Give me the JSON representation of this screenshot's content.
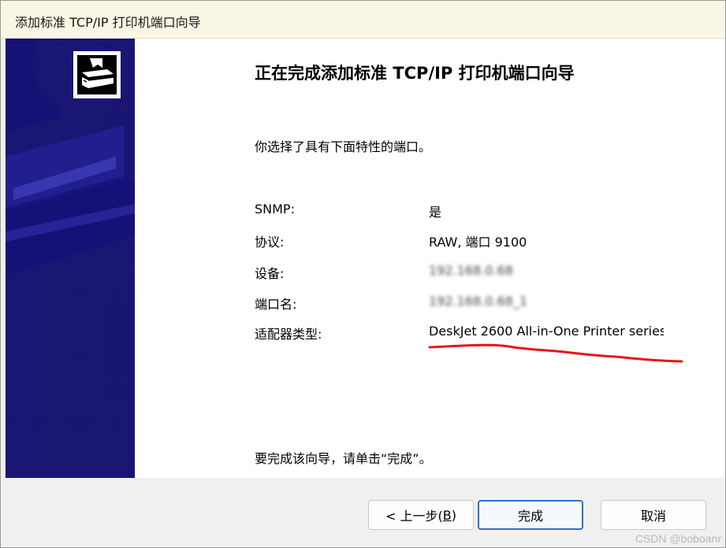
{
  "window": {
    "title": "添加标准 TCP/IP 打印机端口向导"
  },
  "banner": {
    "icon": "printer-wizard-icon",
    "color": "#1e1a8c"
  },
  "content": {
    "heading": "正在完成添加标准 TCP/IP 打印机端口向导",
    "intro": "你选择了具有下面特性的端口。",
    "properties": [
      {
        "label": "SNMP:",
        "value": "是"
      },
      {
        "label": "协议:",
        "value": "RAW, 端口 9100"
      },
      {
        "label": "设备:",
        "value": "192.168.0.68"
      },
      {
        "label": "端口名:",
        "value": "192.168.0.68_1"
      },
      {
        "label": "适配器类型:",
        "value": "DeskJet 2600 All-in-One Printer series"
      }
    ],
    "finish_note": "要完成该向导，请单击“完成”。"
  },
  "buttons": {
    "back_label": "< 上一步(",
    "back_mnemonic": "B",
    "back_suffix": ")",
    "finish_label": "完成",
    "cancel_label": "取消"
  },
  "annotation": {
    "color": "#e8141b"
  },
  "watermark": "CSDN @boboanr"
}
